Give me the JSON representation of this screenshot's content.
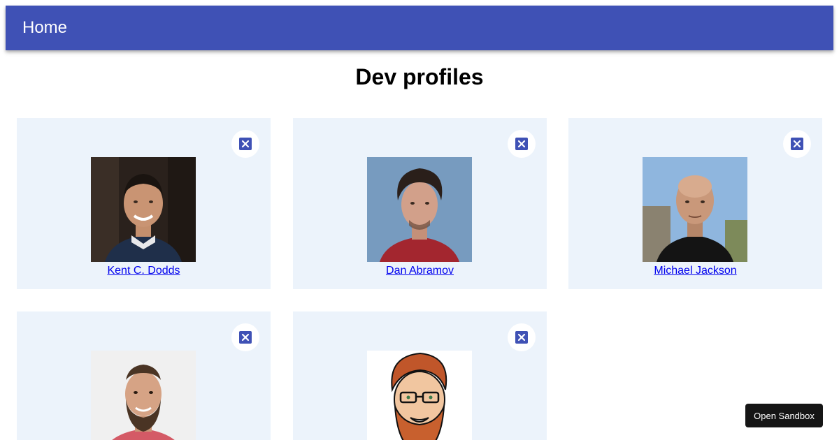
{
  "header": {
    "title": "Home"
  },
  "main": {
    "title": "Dev profiles"
  },
  "profiles": [
    {
      "name": "Kent C. Dodds"
    },
    {
      "name": "Dan Abramov"
    },
    {
      "name": "Michael Jackson"
    },
    {
      "name": ""
    },
    {
      "name": ""
    }
  ],
  "sandbox": {
    "label": "Open Sandbox"
  },
  "colors": {
    "appbar": "#3f51b5",
    "card_bg": "#ecf3fb",
    "link": "#0000ee",
    "close_icon": "#3f51b5"
  }
}
